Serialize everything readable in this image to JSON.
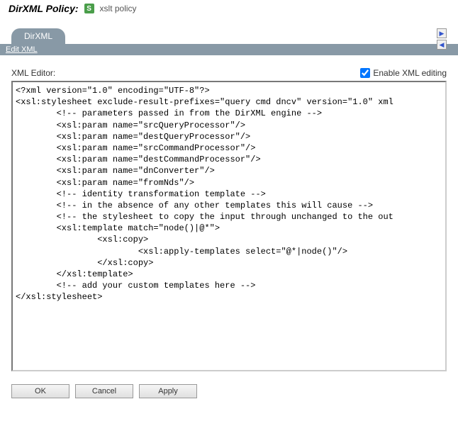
{
  "header": {
    "title": "DirXML Policy:",
    "iconLetter": "S",
    "subtitle": "xslt policy"
  },
  "tab": {
    "label": "DirXML"
  },
  "subbar": {
    "link": "Edit XML"
  },
  "editor": {
    "label": "XML Editor:",
    "enableLabel": "Enable XML editing",
    "enableChecked": true,
    "content": "<?xml version=\"1.0\" encoding=\"UTF-8\"?>\n<xsl:stylesheet exclude-result-prefixes=\"query cmd dncv\" version=\"1.0\" xml\n        <!-- parameters passed in from the DirXML engine -->\n        <xsl:param name=\"srcQueryProcessor\"/>\n        <xsl:param name=\"destQueryProcessor\"/>\n        <xsl:param name=\"srcCommandProcessor\"/>\n        <xsl:param name=\"destCommandProcessor\"/>\n        <xsl:param name=\"dnConverter\"/>\n        <xsl:param name=\"fromNds\"/>\n        <!-- identity transformation template -->\n        <!-- in the absence of any other templates this will cause -->\n        <!-- the stylesheet to copy the input through unchanged to the out\n        <xsl:template match=\"node()|@*\">\n                <xsl:copy>\n                        <xsl:apply-templates select=\"@*|node()\"/>\n                </xsl:copy>\n        </xsl:template>\n        <!-- add your custom templates here -->\n</xsl:stylesheet>"
  },
  "buttons": {
    "ok": "OK",
    "cancel": "Cancel",
    "apply": "Apply"
  }
}
